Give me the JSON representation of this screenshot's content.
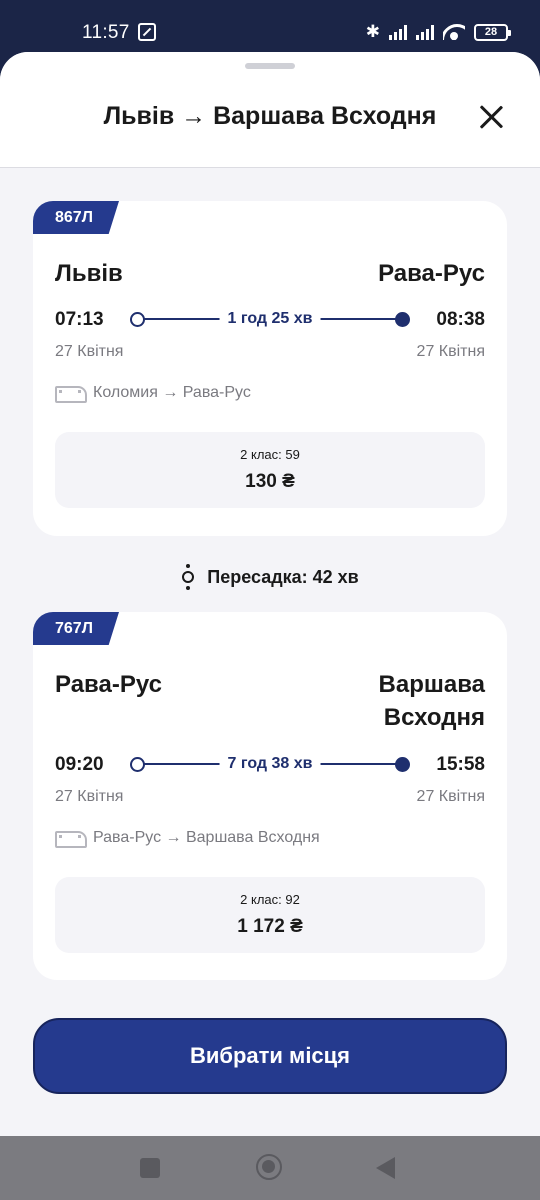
{
  "status_bar": {
    "time": "11:57",
    "battery": "28"
  },
  "header": {
    "title": "Львів → Варшава Всходня"
  },
  "segments": [
    {
      "train_number": "867Л",
      "from_station": "Львів",
      "to_station": "Рава-Рус",
      "departure_time": "07:13",
      "arrival_time": "08:38",
      "duration": "1 год 25 хв",
      "departure_date": "27 Квітня",
      "arrival_date": "27 Квітня",
      "train_route": "Коломия → Рава-Рус",
      "seat_class": "2 клас: 59",
      "price": "130 ₴"
    },
    {
      "train_number": "767Л",
      "from_station": "Рава-Рус",
      "to_station": "Варшава Всходня",
      "departure_time": "09:20",
      "arrival_time": "15:58",
      "duration": "7 год 38 хв",
      "departure_date": "27 Квітня",
      "arrival_date": "27 Квітня",
      "train_route": "Рава-Рус → Варшава Всходня",
      "seat_class": "2 клас: 92",
      "price": "1 172 ₴"
    }
  ],
  "transfer": {
    "label": "Пересадка: 42 хв"
  },
  "cta": {
    "label": "Вибрати місця"
  },
  "colors": {
    "accent": "#253a8e",
    "status_bar": "#1b2547",
    "background": "#f4f4f8"
  }
}
